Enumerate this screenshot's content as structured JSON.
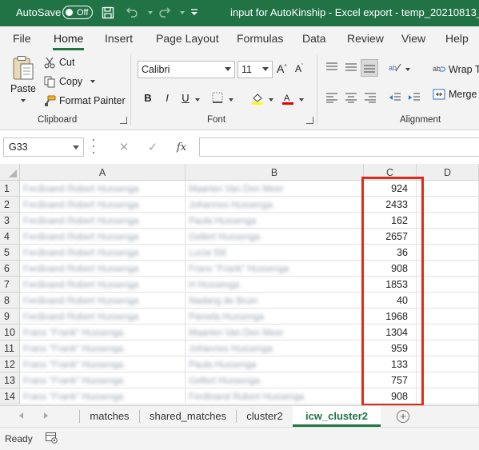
{
  "titlebar": {
    "autosave_label": "AutoSave",
    "autosave_state": "Off",
    "document_title": "input for AutoKinship - Excel export - temp_20210813_1448",
    "accent_color": "#217346"
  },
  "ribbon_tabs": [
    "File",
    "Home",
    "Insert",
    "Page Layout",
    "Formulas",
    "Data",
    "Review",
    "View",
    "Help"
  ],
  "active_ribbon_tab": "Home",
  "clipboard": {
    "paste_label": "Paste",
    "cut_label": "Cut",
    "copy_label": "Copy",
    "format_painter_label": "Format Painter",
    "group_label": "Clipboard"
  },
  "font": {
    "font_name": "Calibri",
    "font_size": "11",
    "bold": "B",
    "italic": "I",
    "underline": "U",
    "group_label": "Font"
  },
  "alignment": {
    "wrap_text_label": "Wrap Te",
    "merge_label": "Merge &",
    "group_label": "Alignment"
  },
  "formula_bar": {
    "name_box": "G33",
    "cancel_symbol": "✕",
    "enter_symbol": "✓",
    "fx_symbol": "fx",
    "formula_value": ""
  },
  "grid": {
    "columns": [
      "A",
      "B",
      "C",
      "D"
    ],
    "rows": [
      {
        "num": "1",
        "a": "Ferdinand Robert Hussenga",
        "b": "Maarten Van Den Meer",
        "c": "924"
      },
      {
        "num": "2",
        "a": "Ferdinand Robert Hussenga",
        "b": "Johannes Hussenga",
        "c": "2433"
      },
      {
        "num": "3",
        "a": "Ferdinand Robert Hussenga",
        "b": "Paula Hussenga",
        "c": "162"
      },
      {
        "num": "4",
        "a": "Ferdinand Robert Hussenga",
        "b": "Gellert Hussenga",
        "c": "2657"
      },
      {
        "num": "5",
        "a": "Ferdinand Robert Hussenga",
        "b": "Lucia Stil",
        "c": "36"
      },
      {
        "num": "6",
        "a": "Ferdinand Robert Hussenga",
        "b": "Frans \"Frank\" Hussenga",
        "c": "908"
      },
      {
        "num": "7",
        "a": "Ferdinand Robert Hussenga",
        "b": "H Hussenga",
        "c": "1853"
      },
      {
        "num": "8",
        "a": "Ferdinand Robert Hussenga",
        "b": "Nadang de Bruin",
        "c": "40"
      },
      {
        "num": "9",
        "a": "Ferdinand Robert Hussenga",
        "b": "Pamela Hussenga",
        "c": "1968"
      },
      {
        "num": "10",
        "a": "Frans \"Frank\" Hussenga",
        "b": "Maarten Van Den Meer",
        "c": "1304"
      },
      {
        "num": "11",
        "a": "Frans \"Frank\" Hussenga",
        "b": "Johannes Hussenga",
        "c": "959"
      },
      {
        "num": "12",
        "a": "Frans \"Frank\" Hussenga",
        "b": "Paula Hussenga",
        "c": "133"
      },
      {
        "num": "13",
        "a": "Frans \"Frank\" Hussenga",
        "b": "Gellert Hussenga",
        "c": "757"
      },
      {
        "num": "14",
        "a": "Frans \"Frank\" Hussenga",
        "b": "Ferdinand Robert Hussenga",
        "c": "908"
      }
    ],
    "highlight_color": "#e02a1a"
  },
  "sheet_tabs": [
    "matches",
    "shared_matches",
    "cluster2",
    "icw_cluster2"
  ],
  "active_sheet": "icw_cluster2",
  "status": {
    "ready_label": "Ready"
  }
}
